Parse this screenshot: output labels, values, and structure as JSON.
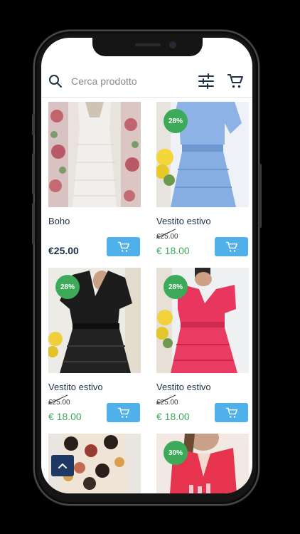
{
  "search": {
    "placeholder": "Cerca prodotto"
  },
  "icons": {
    "search": "search-icon",
    "filter": "sliders-icon",
    "cart": "cart-icon",
    "back_to_top": "chevron-up-icon"
  },
  "colors": {
    "accent_blue": "#4fb0ea",
    "sale_green": "#3daa5a",
    "navy": "#1e3148",
    "back_to_top_bg": "#1e3a64"
  },
  "products": [
    {
      "name": "Boho",
      "price": "€25.00",
      "old_price": "",
      "discount": ""
    },
    {
      "name": "Vestito estivo",
      "price": "€ 18.00",
      "old_price": "€25.00",
      "discount": "28%"
    },
    {
      "name": "Vestito estivo",
      "price": "€ 18.00",
      "old_price": "€25.00",
      "discount": "28%"
    },
    {
      "name": "Vestito estivo",
      "price": "€ 18.00",
      "old_price": "€25.00",
      "discount": "28%"
    },
    {
      "name": "",
      "price": "",
      "old_price": "",
      "discount": ""
    },
    {
      "name": "",
      "price": "",
      "old_price": "",
      "discount": "30%"
    }
  ]
}
